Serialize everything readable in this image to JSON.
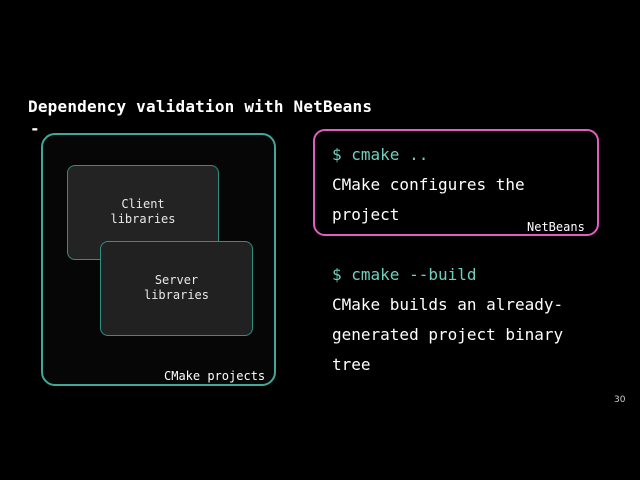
{
  "slide": {
    "title": "Dependency validation with NetBeans",
    "title_dash": "-",
    "page_number": "30"
  },
  "diagram": {
    "outer_label": "CMake projects",
    "client_label_line1": "Client",
    "client_label_line2": "libraries",
    "server_label_line1": "Server",
    "server_label_line2": "libraries"
  },
  "commands": {
    "cmd1": "$ cmake ..",
    "desc1_line1": "CMake configures the",
    "desc1_line2": "project",
    "netbeans_label": "NetBeans",
    "cmd2": "$ cmake --build",
    "desc2_line1": "CMake builds an already-",
    "desc2_line2": "generated project binary",
    "desc2_line3": "tree"
  },
  "colors": {
    "background": "#000000",
    "teal_border": "#3fa898",
    "magenta_border": "#e05fc0",
    "command_text": "#6fcfbf"
  }
}
